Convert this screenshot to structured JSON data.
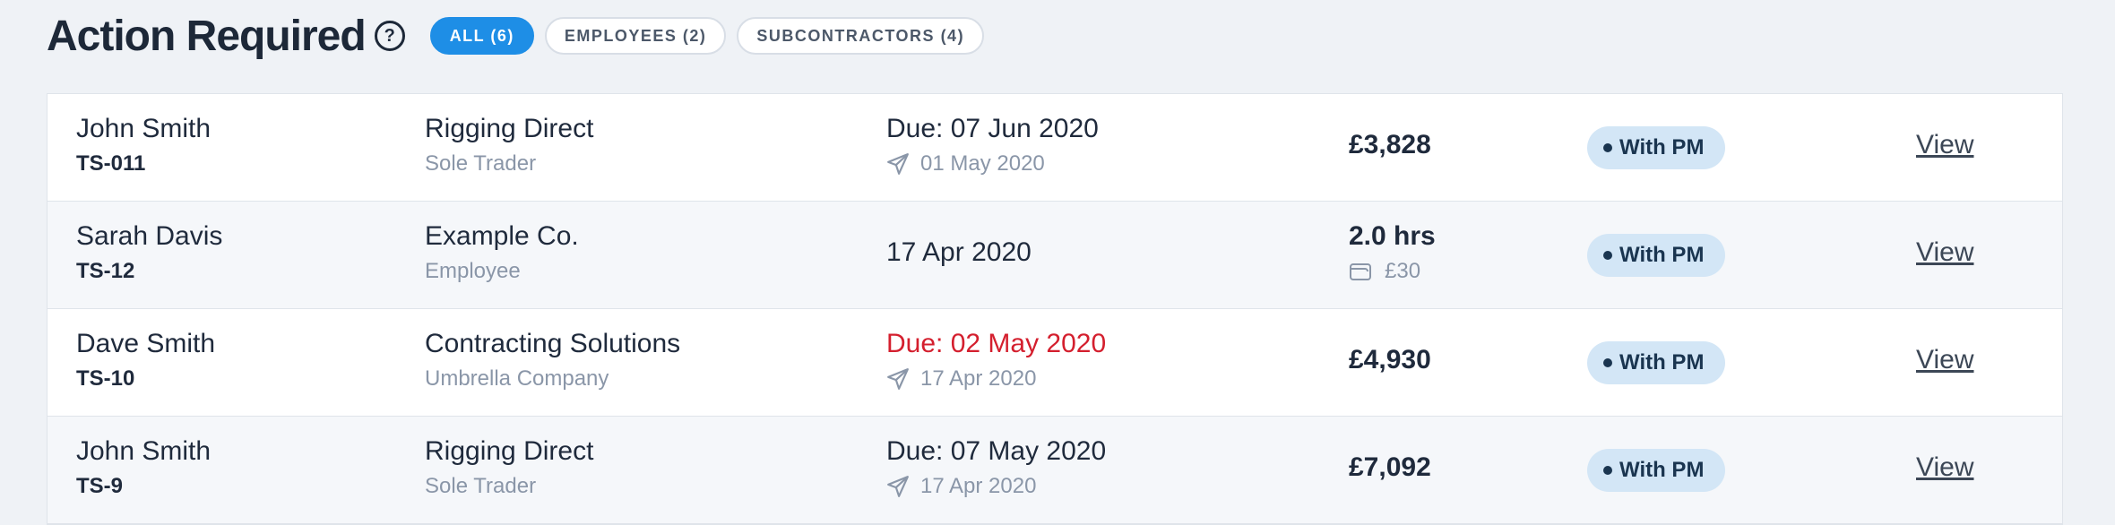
{
  "header": {
    "title": "Action Required",
    "help_icon": "?",
    "filters": [
      {
        "label": "ALL (6)",
        "active": true
      },
      {
        "label": "EMPLOYEES (2)",
        "active": false
      },
      {
        "label": "SUBCONTRACTORS (4)",
        "active": false
      }
    ]
  },
  "rows": [
    {
      "name": "John Smith",
      "ref": "TS-011",
      "company": "Rigging Direct",
      "company_type": "Sole Trader",
      "date": "Due: 07 Jun 2020",
      "sent": "01 May 2020",
      "amount": "£3,828",
      "status": "With PM",
      "action": "View"
    },
    {
      "name": "Sarah Davis",
      "ref": "TS-12",
      "company": "Example Co.",
      "company_type": "Employee",
      "date": "17 Apr 2020",
      "amount": "2.0 hrs",
      "amount_sub": "£30",
      "status": "With PM",
      "action": "View"
    },
    {
      "name": "Dave Smith",
      "ref": "TS-10",
      "company": "Contracting Solutions",
      "company_type": "Umbrella Company",
      "date": "Due: 02 May 2020",
      "sent": "17 Apr 2020",
      "amount": "£4,930",
      "status": "With PM",
      "action": "View"
    },
    {
      "name": "John Smith",
      "ref": "TS-9",
      "company": "Rigging Direct",
      "company_type": "Sole Trader",
      "date": "Due: 07 May 2020",
      "sent": "17 Apr 2020",
      "amount": "£7,092",
      "status": "With PM",
      "action": "View"
    }
  ],
  "colors": {
    "accent": "#1e8ee6",
    "overdue": "#d41f2e",
    "badge_bg": "#d3e6f6",
    "muted_text": "#8a96a8"
  },
  "icons": {
    "help": "question-circle-icon",
    "sent": "paper-plane-icon",
    "expense": "wallet-icon"
  }
}
